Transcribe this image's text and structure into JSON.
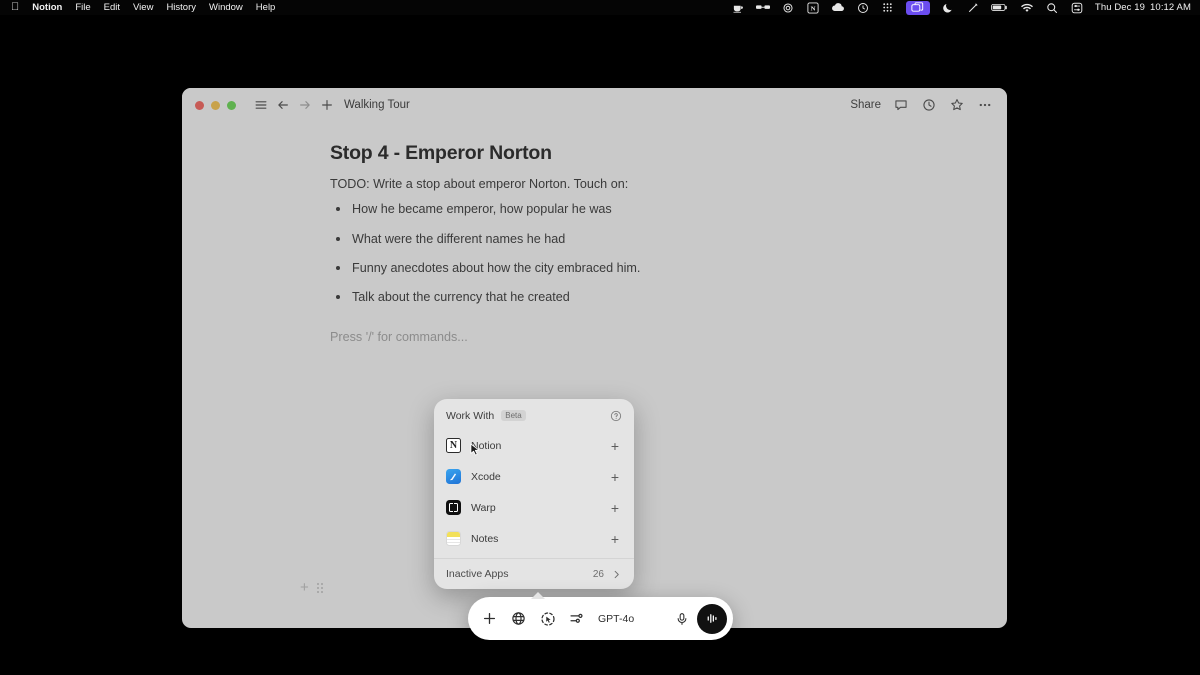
{
  "menubar": {
    "apple_icon": "apple-icon",
    "items": [
      {
        "label": "Notion",
        "bold": true
      },
      {
        "label": "File",
        "bold": false
      },
      {
        "label": "Edit",
        "bold": false
      },
      {
        "label": "View",
        "bold": false
      },
      {
        "label": "History",
        "bold": false
      },
      {
        "label": "Window",
        "bold": false
      },
      {
        "label": "Help",
        "bold": false
      }
    ],
    "status_icons": [
      "coffee-icon",
      "glasses-icon",
      "gear-icon",
      "notion-menu-icon",
      "cloud-icon",
      "clock-sync-icon",
      "grid-apps-icon",
      "screen-share-icon",
      "moon-icon",
      "pen-icon",
      "battery-icon",
      "wifi-icon",
      "search-icon",
      "control-center-icon"
    ],
    "highlight_color": "#6b4df0",
    "clock_day": "Thu Dec 19",
    "clock_time": "10:12 AM"
  },
  "window": {
    "title": "Walking Tour",
    "share_label": "Share",
    "left_icons": [
      "sidebar-icon",
      "back-arrow-icon",
      "forward-arrow-icon",
      "new-page-icon"
    ],
    "right_icons": [
      "comment-icon",
      "history-clock-icon",
      "star-icon",
      "more-options-icon"
    ],
    "background": "#c9c9c9"
  },
  "document": {
    "title": "Stop 4 - Emperor Norton",
    "intro": "TODO: Write a stop about emperor Norton. Touch on:",
    "bullets": [
      "How he became emperor, how popular he was",
      "What were the different names he had",
      "Funny anecdotes about how the city embraced him.",
      "Talk about the currency that he created"
    ],
    "placeholder": "Press '/' for commands...",
    "block_add_icon": "plus-icon",
    "block_drag_icon": "drag-handle-icon"
  },
  "popup": {
    "title": "Work With",
    "badge": "Beta",
    "info_icon": "info-circle-icon",
    "apps": [
      {
        "name": "Notion",
        "icon": "notion-app-icon",
        "add_icon": "plus-icon"
      },
      {
        "name": "Xcode",
        "icon": "xcode-app-icon",
        "add_icon": "plus-icon"
      },
      {
        "name": "Warp",
        "icon": "warp-app-icon",
        "add_icon": "plus-icon"
      },
      {
        "name": "Notes",
        "icon": "notes-app-icon",
        "add_icon": "plus-icon"
      }
    ],
    "footer_label": "Inactive Apps",
    "footer_count": "26",
    "footer_chevron": "chevron-right-icon"
  },
  "gptbar": {
    "add_icon": "plus-icon",
    "web_icon": "globe-icon",
    "workwith_icon": "work-with-cursor-icon",
    "model_icon": "model-sliders-icon",
    "model": "GPT-4o",
    "mic_icon": "microphone-icon",
    "voice_icon": "voice-wave-icon"
  }
}
